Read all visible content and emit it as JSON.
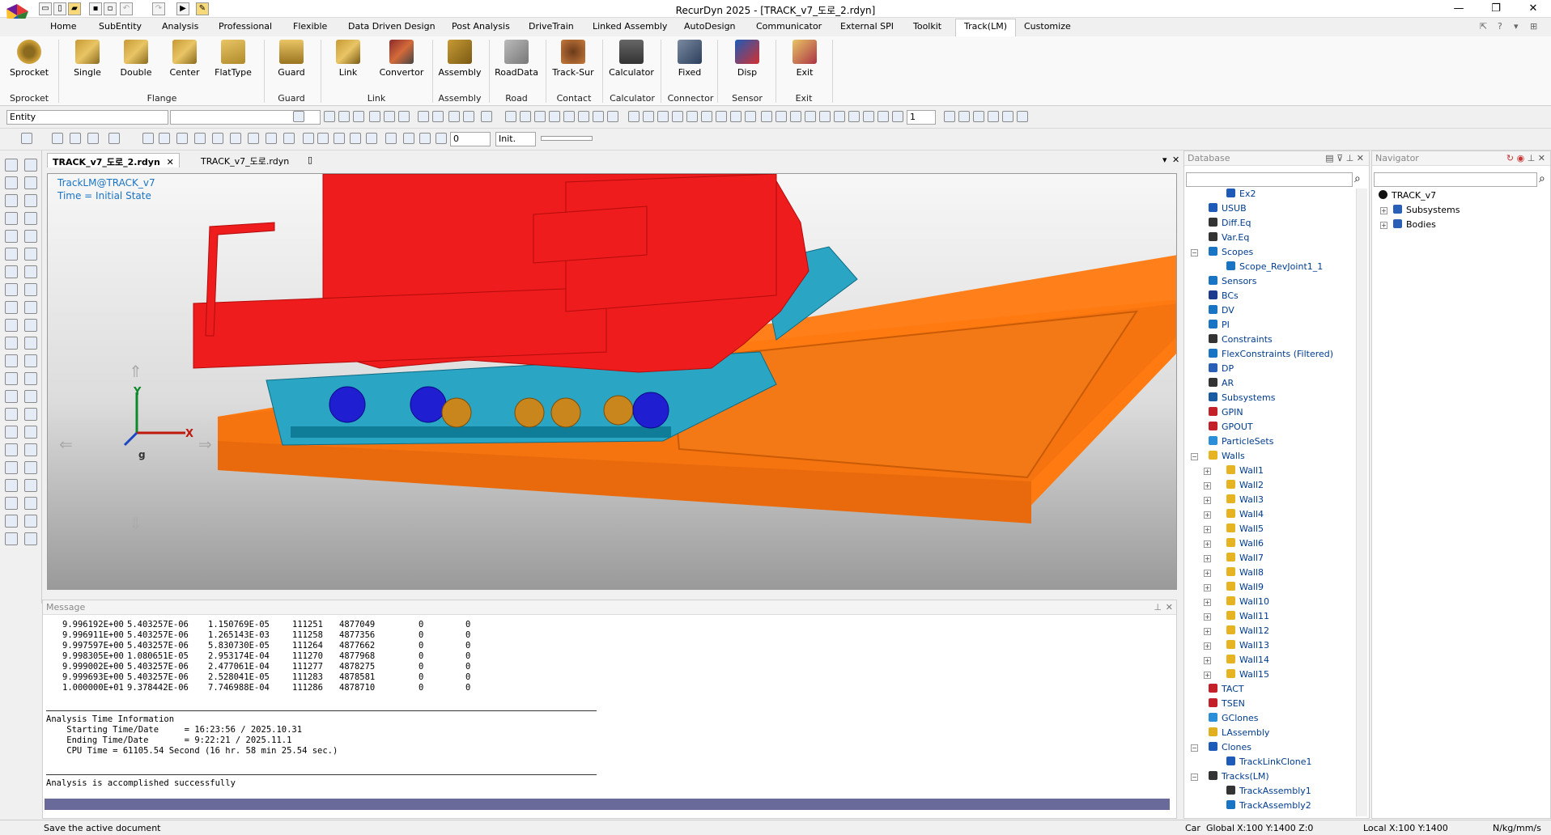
{
  "window": {
    "title": "RecurDyn 2025  - [TRACK_v7_도로_2.rdyn]"
  },
  "menu_tabs": [
    "Home",
    "SubEntity",
    "Analysis",
    "Professional",
    "Flexible",
    "Data Driven Design",
    "Post Analysis",
    "DriveTrain",
    "Linked Assembly",
    "AutoDesign",
    "Communicator",
    "External SPI",
    "Toolkit",
    "Track(LM)",
    "Customize"
  ],
  "active_tab": "Track(LM)",
  "ribbon": {
    "buttons": [
      "Sprocket",
      "Single",
      "Double",
      "Center",
      "FlatType",
      "Guard",
      "Link",
      "Convertor",
      "Assembly",
      "RoadData",
      "Track-Sur",
      "Calculator",
      "Fixed",
      "Disp",
      "Exit"
    ],
    "groups": [
      "Sprocket",
      "Flange",
      "Guard",
      "Link",
      "Assembly",
      "Road",
      "Contact",
      "Calculator",
      "Connector",
      "Sensor",
      "Exit"
    ]
  },
  "toolbar": {
    "entity_combo": "Entity",
    "frame_value": "1",
    "time_field": "0",
    "init_field": "Init."
  },
  "doc_tabs": [
    "TRACK_v7_도로_2.rdyn",
    "TRACK_v7_도로.rdyn"
  ],
  "viewport": {
    "overlay_line1": "TrackLM@TRACK_v7",
    "overlay_line2": "Time = Initial State",
    "axis_x": "X",
    "axis_y": "Y",
    "axis_g": "g"
  },
  "message": {
    "header": "Message",
    "rows": [
      [
        "9.996192E+00",
        "5.403257E-06",
        "1.150769E-05",
        "111251",
        "4877049",
        "0",
        "0"
      ],
      [
        "9.996911E+00",
        "5.403257E-06",
        "1.265143E-03",
        "111258",
        "4877356",
        "0",
        "0"
      ],
      [
        "9.997597E+00",
        "5.403257E-06",
        "5.830730E-05",
        "111264",
        "4877662",
        "0",
        "0"
      ],
      [
        "9.998305E+00",
        "1.080651E-05",
        "2.953174E-04",
        "111270",
        "4877968",
        "0",
        "0"
      ],
      [
        "9.999002E+00",
        "5.403257E-06",
        "2.477061E-04",
        "111277",
        "4878275",
        "0",
        "0"
      ],
      [
        "9.999693E+00",
        "5.403257E-06",
        "2.528041E-05",
        "111283",
        "4878581",
        "0",
        "0"
      ],
      [
        "1.000000E+01",
        "9.378442E-06",
        "7.746988E-04",
        "111286",
        "4878710",
        "0",
        "0"
      ]
    ],
    "time_header": "Analysis Time Information",
    "start_line": "    Starting Time/Date     = 16:23:56 / 2025.10.31",
    "end_line": "    Ending Time/Date       = 9:22:21 / 2025.11.1",
    "cpu_line": "    CPU Time = 61105.54 Second (16 hr. 58 min 25.54 sec.)",
    "success": "Analysis is accomplished successfully"
  },
  "database": {
    "header": "Database",
    "search_placeholder": "",
    "items": [
      {
        "label": "Ex2",
        "level": 2
      },
      {
        "label": "USUB",
        "level": 1
      },
      {
        "label": "Diff.Eq",
        "level": 1
      },
      {
        "label": "Var.Eq",
        "level": 1
      },
      {
        "label": "Scopes",
        "level": 1,
        "expanded": true
      },
      {
        "label": "Scope_RevJoint1_1",
        "level": 2
      },
      {
        "label": "Sensors",
        "level": 1
      },
      {
        "label": "BCs",
        "level": 1
      },
      {
        "label": "DV",
        "level": 1
      },
      {
        "label": "PI",
        "level": 1
      },
      {
        "label": "Constraints",
        "level": 1
      },
      {
        "label": "FlexConstraints (Filtered)",
        "level": 1
      },
      {
        "label": "DP",
        "level": 1
      },
      {
        "label": "AR",
        "level": 1
      },
      {
        "label": "Subsystems",
        "level": 1
      },
      {
        "label": "GPIN",
        "level": 1
      },
      {
        "label": "GPOUT",
        "level": 1
      },
      {
        "label": "ParticleSets",
        "level": 1
      },
      {
        "label": "Walls",
        "level": 1,
        "expanded": true
      },
      {
        "label": "Wall1",
        "level": 2
      },
      {
        "label": "Wall2",
        "level": 2
      },
      {
        "label": "Wall3",
        "level": 2
      },
      {
        "label": "Wall4",
        "level": 2
      },
      {
        "label": "Wall5",
        "level": 2
      },
      {
        "label": "Wall6",
        "level": 2
      },
      {
        "label": "Wall7",
        "level": 2
      },
      {
        "label": "Wall8",
        "level": 2
      },
      {
        "label": "Wall9",
        "level": 2
      },
      {
        "label": "Wall10",
        "level": 2
      },
      {
        "label": "Wall11",
        "level": 2
      },
      {
        "label": "Wall12",
        "level": 2
      },
      {
        "label": "Wall13",
        "level": 2
      },
      {
        "label": "Wall14",
        "level": 2
      },
      {
        "label": "Wall15",
        "level": 2
      },
      {
        "label": "TACT",
        "level": 1
      },
      {
        "label": "TSEN",
        "level": 1
      },
      {
        "label": "GClones",
        "level": 1
      },
      {
        "label": "LAssembly",
        "level": 1
      },
      {
        "label": "Clones",
        "level": 1,
        "expanded": true
      },
      {
        "label": "TrackLinkClone1",
        "level": 2
      },
      {
        "label": "Tracks(LM)",
        "level": 1,
        "expanded": true
      },
      {
        "label": "TrackAssembly1",
        "level": 2
      },
      {
        "label": "TrackAssembly2",
        "level": 2
      }
    ]
  },
  "navigator": {
    "header": "Navigator",
    "items": [
      {
        "label": "TRACK_v7",
        "level": 0
      },
      {
        "label": "Subsystems",
        "level": 1
      },
      {
        "label": "Bodies",
        "level": 1
      }
    ]
  },
  "status": {
    "message": "Save the active document",
    "car": "Car",
    "global": "Global",
    "global_coords": "X:100 Y:1400 Z:0",
    "local": "Local",
    "local_coords": "X:100 Y:1400",
    "units": "N/kg/mm/s"
  }
}
